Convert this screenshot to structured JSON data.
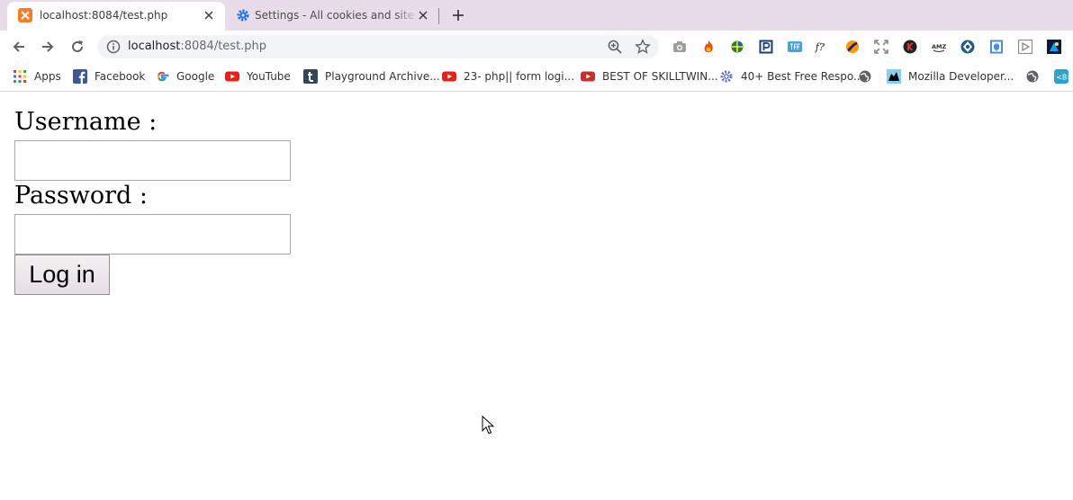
{
  "tabs": [
    {
      "title": "localhost:8084/test.php",
      "favicon": "xampp-icon",
      "active": true
    },
    {
      "title": "Settings - All cookies and site data",
      "favicon": "settings-gear-icon",
      "active": false
    }
  ],
  "toolbar": {
    "url_host": "localhost",
    "url_rest": ":8084/test.php"
  },
  "extensions": [
    "camera-icon",
    "fire-extension-icon",
    "globe-extension-icon",
    "p-extension-icon",
    "tff-extension-icon",
    "fx-extension-icon",
    "swirl-extension-icon",
    "expand-icon",
    "k-extension-icon",
    "amz-extension-icon",
    "blue-circle-extension-icon",
    "shield-extension-icon",
    "play-extension-icon",
    "dark-extension-icon"
  ],
  "bookmarks": [
    {
      "label": "Apps",
      "icon": "apps-grid-icon"
    },
    {
      "label": "Facebook",
      "icon": "facebook-icon"
    },
    {
      "label": "Google",
      "icon": "google-icon"
    },
    {
      "label": "YouTube",
      "icon": "youtube-icon"
    },
    {
      "label": "Playground Archive...",
      "icon": "tumblr-icon"
    },
    {
      "label": "23- php|| form logi...",
      "icon": "youtube-icon"
    },
    {
      "label": "BEST OF SKILLTWIN...",
      "icon": "youtube-icon"
    },
    {
      "label": "40+ Best Free Respo...",
      "icon": "gear-icon"
    },
    {
      "label": "",
      "icon": "globe-icon"
    },
    {
      "label": "Mozilla Developer...",
      "icon": "mdn-icon"
    },
    {
      "label": "",
      "icon": "globe-icon"
    },
    {
      "label": "",
      "icon": "bootstrap-icon"
    }
  ],
  "form": {
    "username_label": "Username :",
    "username_value": "",
    "password_label": "Password :",
    "password_value": "",
    "submit_label": "Log in"
  },
  "colors": {
    "tabstrip_bg": "#e8dcea",
    "omnibox_bg": "#f1f3f4",
    "button_bg": "#e7dde6"
  }
}
